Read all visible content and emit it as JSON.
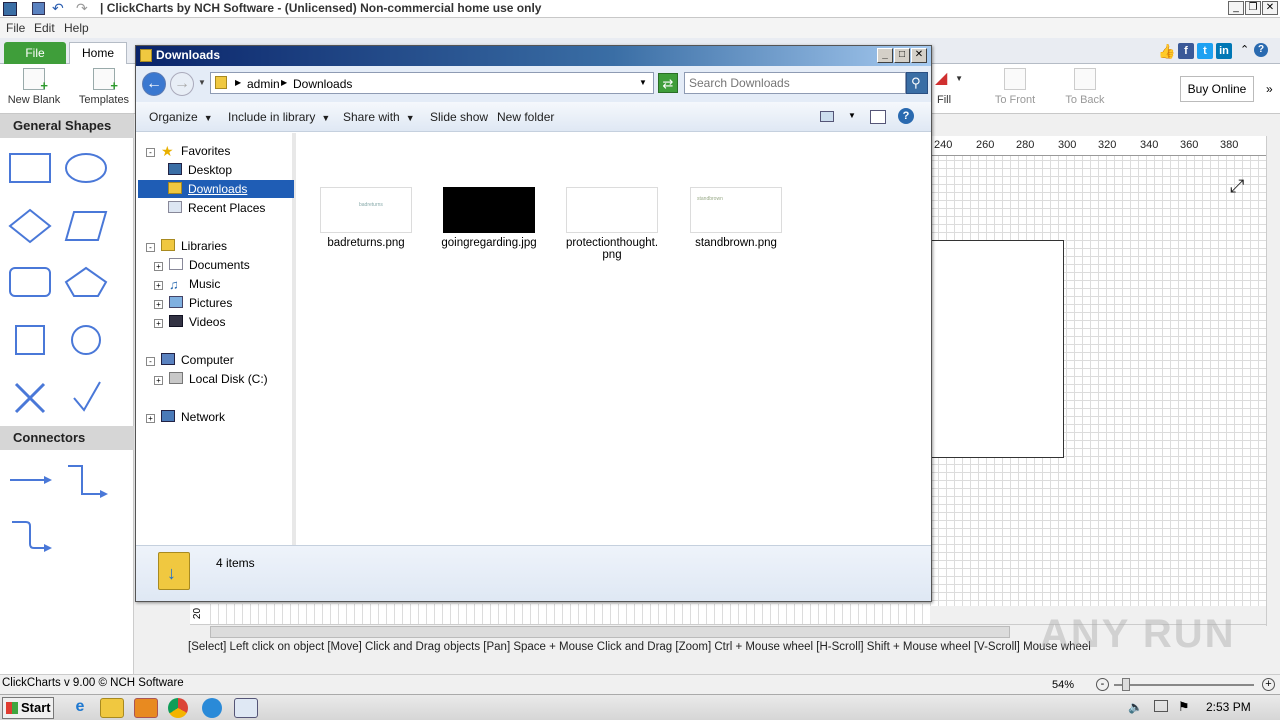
{
  "app": {
    "title": "| ClickCharts by NCH Software - (Unlicensed) Non-commercial home use only",
    "menu": [
      "File",
      "Edit",
      "Help"
    ],
    "tabs": {
      "file": "File",
      "home": "Home"
    },
    "ribbon": {
      "new_blank": "New Blank",
      "templates": "Templates",
      "fill": "Fill",
      "to_front": "To Front",
      "to_back": "To Back",
      "buy_online": "Buy Online"
    },
    "left_panel": {
      "general_shapes": "General Shapes",
      "connectors": "Connectors"
    },
    "ruler_ticks": [
      "240",
      "260",
      "280",
      "300",
      "320",
      "340",
      "360",
      "380"
    ],
    "ruler_left_label": "20",
    "status_help": "[Select] Left click on object  [Move] Click and Drag objects  [Pan] Space + Mouse Click and Drag  [Zoom] Ctrl + Mouse wheel  [H-Scroll] Shift + Mouse wheel  [V-Scroll] Mouse wheel",
    "version": "ClickCharts v 9.00 © NCH Software",
    "zoom": "54%",
    "watermark": "ANY RUN"
  },
  "explorer": {
    "title": "Downloads",
    "address": {
      "root": "admin",
      "folder": "Downloads"
    },
    "search_placeholder": "Search Downloads",
    "toolbar": {
      "organize": "Organize",
      "include_in_library": "Include in library",
      "share_with": "Share with",
      "slide_show": "Slide show",
      "new_folder": "New folder"
    },
    "tree": {
      "favorites": "Favorites",
      "desktop": "Desktop",
      "downloads": "Downloads",
      "recent_places": "Recent Places",
      "libraries": "Libraries",
      "documents": "Documents",
      "music": "Music",
      "pictures": "Pictures",
      "videos": "Videos",
      "computer": "Computer",
      "local_disk": "Local Disk (C:)",
      "network": "Network"
    },
    "files": [
      {
        "name": "badreturns.png",
        "thumb_text": "badreturns"
      },
      {
        "name": "goingregarding.jpg",
        "thumb_text": ""
      },
      {
        "name": "protectionthought.png",
        "thumb_text": ""
      },
      {
        "name": "standbrown.png",
        "thumb_text": "standbrown"
      }
    ],
    "item_count": "4 items"
  },
  "taskbar": {
    "start": "Start",
    "clock": "2:53 PM"
  }
}
